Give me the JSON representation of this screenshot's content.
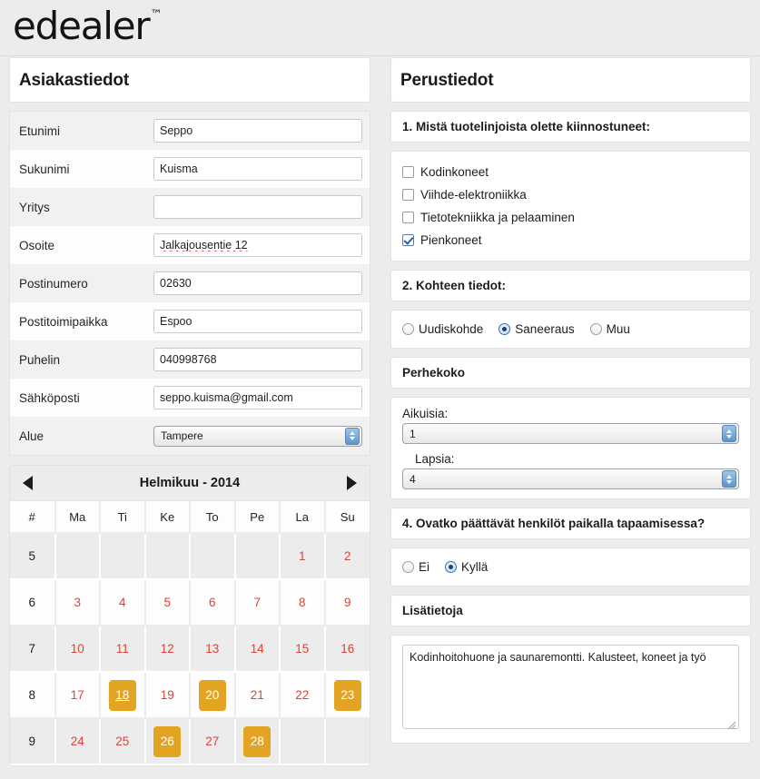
{
  "brand": {
    "name": "edealer",
    "tm": "™"
  },
  "left": {
    "title": "Asiakastiedot",
    "fields": [
      {
        "label": "Etunimi",
        "value": "Seppo",
        "type": "text"
      },
      {
        "label": "Sukunimi",
        "value": "Kuisma",
        "type": "text"
      },
      {
        "label": "Yritys",
        "value": "",
        "type": "text"
      },
      {
        "label": "Osoite",
        "value": "Jalkajousentie 12",
        "type": "text-spell"
      },
      {
        "label": "Postinumero",
        "value": "02630",
        "type": "text"
      },
      {
        "label": "Postitoimipaikka",
        "value": "Espoo",
        "type": "text"
      },
      {
        "label": "Puhelin",
        "value": "040998768",
        "type": "text"
      },
      {
        "label": "Sähköposti",
        "value": "seppo.kuisma@gmail.com",
        "type": "text"
      },
      {
        "label": "Alue",
        "value": "Tampere",
        "type": "select"
      }
    ]
  },
  "calendar": {
    "title": "Helmikuu - 2014",
    "prev_icon": "arrow-left-icon",
    "next_icon": "arrow-right-icon",
    "headers": [
      "#",
      "Ma",
      "Ti",
      "Ke",
      "To",
      "Pe",
      "La",
      "Su"
    ],
    "weeks": [
      {
        "week": "5",
        "days": [
          "",
          "",
          "",
          "",
          "",
          "1",
          "2"
        ]
      },
      {
        "week": "6",
        "days": [
          "3",
          "4",
          "5",
          "6",
          "7",
          "8",
          "9"
        ]
      },
      {
        "week": "7",
        "days": [
          "10",
          "11",
          "12",
          "13",
          "14",
          "15",
          "16"
        ]
      },
      {
        "week": "8",
        "days": [
          "17",
          "18",
          "19",
          "20",
          "21",
          "22",
          "23"
        ]
      },
      {
        "week": "9",
        "days": [
          "24",
          "25",
          "26",
          "27",
          "28",
          "",
          ""
        ]
      }
    ],
    "highlighted": [
      "18",
      "20",
      "23",
      "26",
      "28"
    ],
    "today": "18",
    "highlight_color": "#e3a423",
    "day_color": "#d9453a"
  },
  "right": {
    "title": "Perustiedot",
    "q1": {
      "text": "1. Mistä tuotelinjoista olette kiinnostuneet:",
      "options": [
        {
          "label": "Kodinkoneet",
          "checked": false
        },
        {
          "label": "Viihde-elektroniikka",
          "checked": false
        },
        {
          "label": "Tietotekniikka ja pelaaminen",
          "checked": false
        },
        {
          "label": "Pienkoneet",
          "checked": true
        }
      ]
    },
    "q2": {
      "text": "2. Kohteen tiedot:",
      "options": [
        {
          "label": "Uudiskohde",
          "selected": false
        },
        {
          "label": "Saneeraus",
          "selected": true
        },
        {
          "label": "Muu",
          "selected": false
        }
      ]
    },
    "family": {
      "heading": "Perhekoko",
      "adults_label": "Aikuisia:",
      "adults_value": "1",
      "children_label": "Lapsia:",
      "children_value": "4"
    },
    "q4": {
      "text": "4. Ovatko päättävät henkilöt paikalla tapaamisessa?",
      "options": [
        {
          "label": "Ei",
          "selected": false
        },
        {
          "label": "Kyllä",
          "selected": true
        }
      ]
    },
    "notes": {
      "heading": "Lisätietoja",
      "value": "Kodinhoitohuone ja saunaremontti. Kalusteet, koneet ja työ",
      "placeholder": ""
    }
  }
}
